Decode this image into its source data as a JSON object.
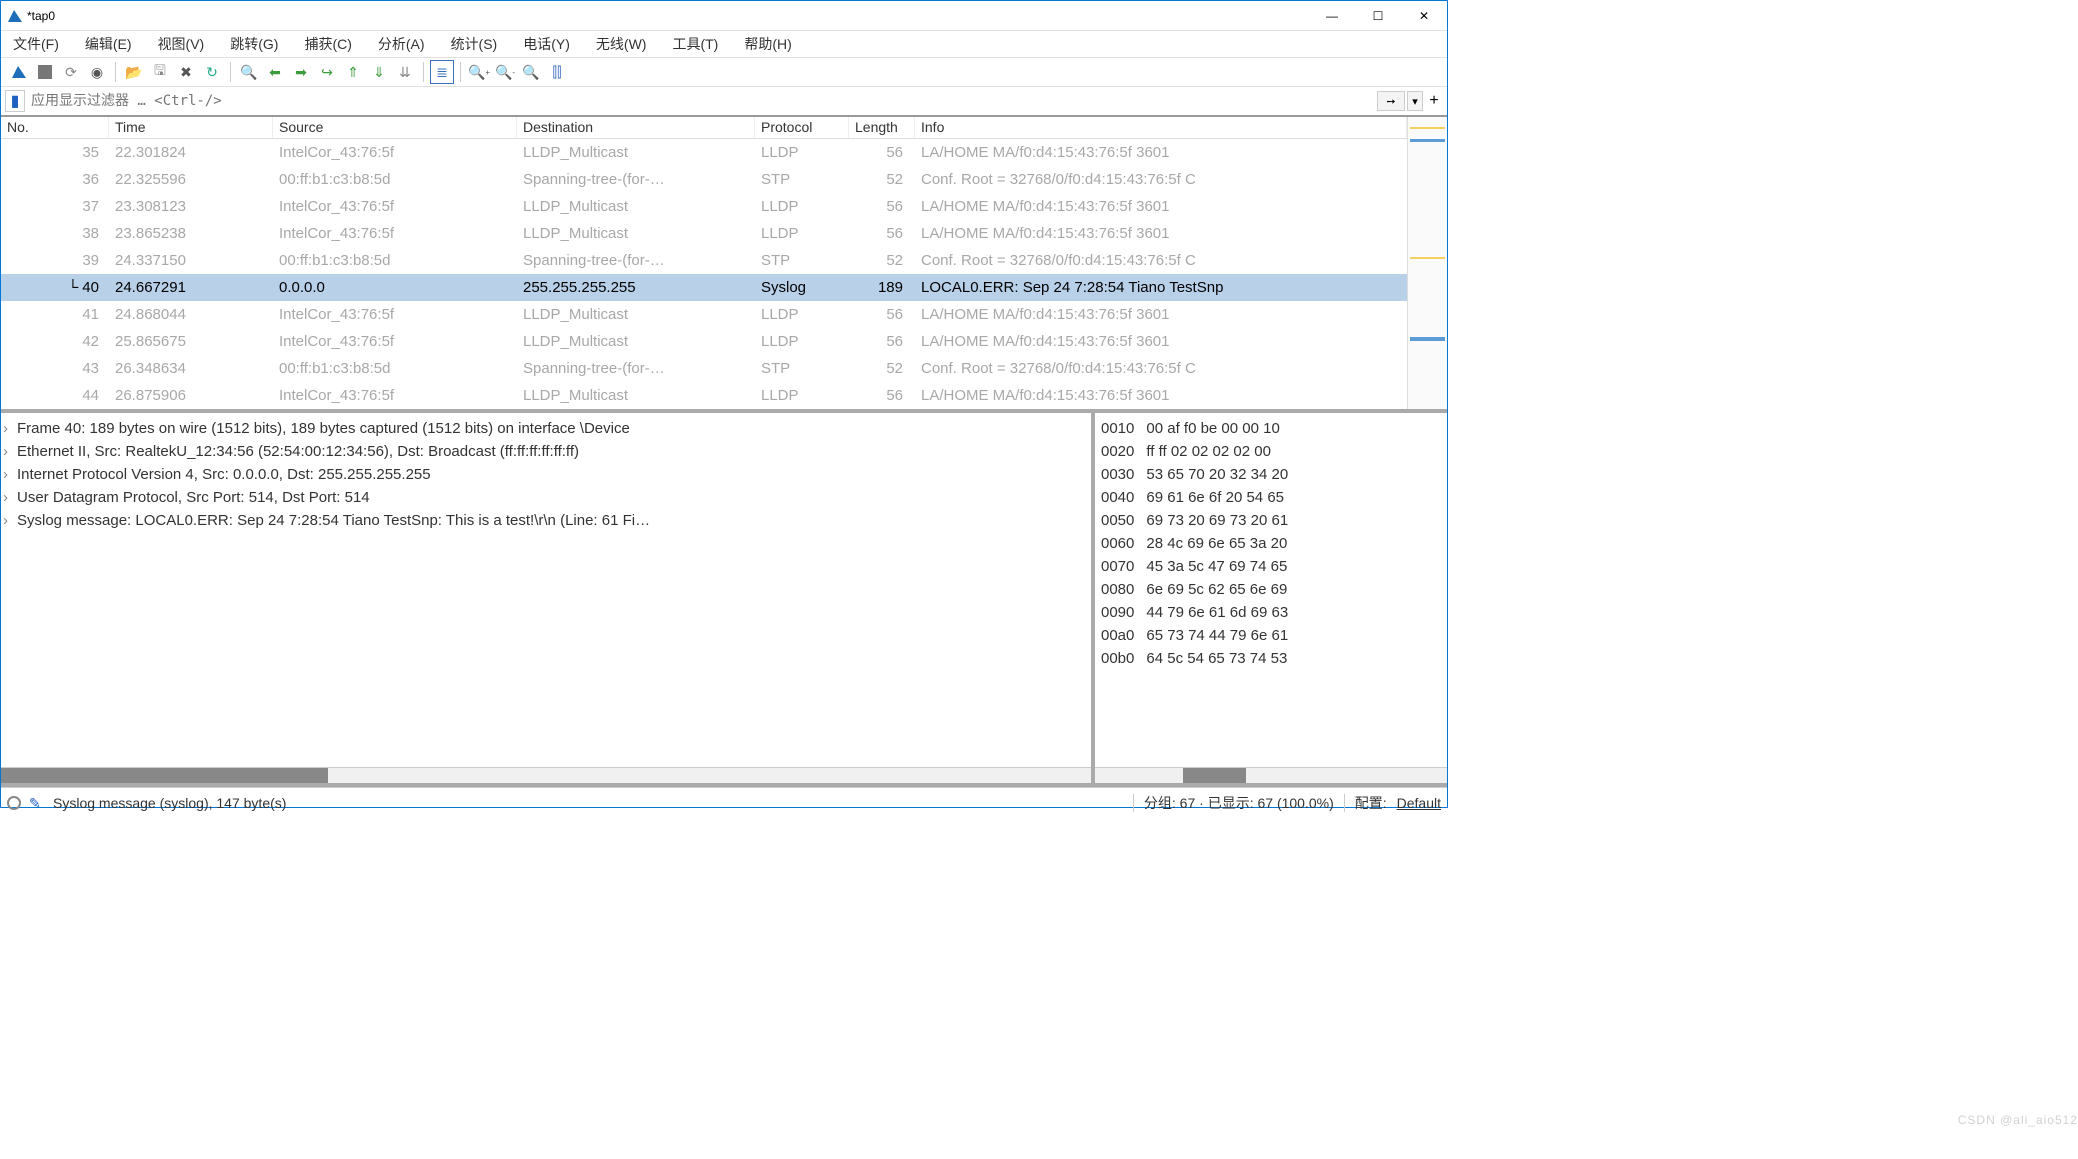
{
  "window": {
    "title": "*tap0"
  },
  "menu": [
    "文件(F)",
    "编辑(E)",
    "视图(V)",
    "跳转(G)",
    "捕获(C)",
    "分析(A)",
    "统计(S)",
    "电话(Y)",
    "无线(W)",
    "工具(T)",
    "帮助(H)"
  ],
  "filter_placeholder": "应用显示过滤器 … <Ctrl-/>",
  "columns": [
    "No.",
    "Time",
    "Source",
    "Destination",
    "Protocol",
    "Length",
    "Info"
  ],
  "packets": [
    {
      "no": "35",
      "time": "22.301824",
      "src": "IntelCor_43:76:5f",
      "dst": "LLDP_Multicast",
      "proto": "LLDP",
      "len": "56",
      "info": "LA/HOME MA/f0:d4:15:43:76:5f 3601",
      "sel": false
    },
    {
      "no": "36",
      "time": "22.325596",
      "src": "00:ff:b1:c3:b8:5d",
      "dst": "Spanning-tree-(for-…",
      "proto": "STP",
      "len": "52",
      "info": "Conf. Root = 32768/0/f0:d4:15:43:76:5f  C",
      "sel": false
    },
    {
      "no": "37",
      "time": "23.308123",
      "src": "IntelCor_43:76:5f",
      "dst": "LLDP_Multicast",
      "proto": "LLDP",
      "len": "56",
      "info": "LA/HOME MA/f0:d4:15:43:76:5f 3601",
      "sel": false
    },
    {
      "no": "38",
      "time": "23.865238",
      "src": "IntelCor_43:76:5f",
      "dst": "LLDP_Multicast",
      "proto": "LLDP",
      "len": "56",
      "info": "LA/HOME MA/f0:d4:15:43:76:5f 3601",
      "sel": false
    },
    {
      "no": "39",
      "time": "24.337150",
      "src": "00:ff:b1:c3:b8:5d",
      "dst": "Spanning-tree-(for-…",
      "proto": "STP",
      "len": "52",
      "info": "Conf. Root = 32768/0/f0:d4:15:43:76:5f  C",
      "sel": false
    },
    {
      "no": "40",
      "time": "24.667291",
      "src": "0.0.0.0",
      "dst": "255.255.255.255",
      "proto": "Syslog",
      "len": "189",
      "info": "LOCAL0.ERR:  Sep 24 7:28:54 Tiano TestSnp",
      "sel": true
    },
    {
      "no": "41",
      "time": "24.868044",
      "src": "IntelCor_43:76:5f",
      "dst": "LLDP_Multicast",
      "proto": "LLDP",
      "len": "56",
      "info": "LA/HOME MA/f0:d4:15:43:76:5f 3601",
      "sel": false
    },
    {
      "no": "42",
      "time": "25.865675",
      "src": "IntelCor_43:76:5f",
      "dst": "LLDP_Multicast",
      "proto": "LLDP",
      "len": "56",
      "info": "LA/HOME MA/f0:d4:15:43:76:5f 3601",
      "sel": false
    },
    {
      "no": "43",
      "time": "26.348634",
      "src": "00:ff:b1:c3:b8:5d",
      "dst": "Spanning-tree-(for-…",
      "proto": "STP",
      "len": "52",
      "info": "Conf. Root = 32768/0/f0:d4:15:43:76:5f  C",
      "sel": false
    },
    {
      "no": "44",
      "time": "26.875906",
      "src": "IntelCor_43:76:5f",
      "dst": "LLDP_Multicast",
      "proto": "LLDP",
      "len": "56",
      "info": "LA/HOME MA/f0:d4:15:43:76:5f 3601",
      "sel": false
    }
  ],
  "tree": [
    "Frame 40: 189 bytes on wire (1512 bits), 189 bytes captured (1512 bits) on interface \\Device",
    "Ethernet II, Src: RealtekU_12:34:56 (52:54:00:12:34:56), Dst: Broadcast (ff:ff:ff:ff:ff:ff)",
    "Internet Protocol Version 4, Src: 0.0.0.0, Dst: 255.255.255.255",
    "User Datagram Protocol, Src Port: 514, Dst Port: 514",
    "Syslog message: LOCAL0.ERR:  Sep 24 7:28:54 Tiano TestSnp: This is a test!\\r\\n (Line: 61 Fi…"
  ],
  "hex": [
    {
      "off": "0010",
      "b": "00 af f0 be 00 00 10 "
    },
    {
      "off": "0020",
      "b": "ff ff 02 02 02 02 00 "
    },
    {
      "off": "0030",
      "b": "53 65 70 20 32 34 20 "
    },
    {
      "off": "0040",
      "b": "69 61 6e 6f 20 54 65 "
    },
    {
      "off": "0050",
      "b": "69 73 20 69 73 20 61 "
    },
    {
      "off": "0060",
      "b": "28 4c 69 6e 65 3a 20 "
    },
    {
      "off": "0070",
      "b": "45 3a 5c 47 69 74 65 "
    },
    {
      "off": "0080",
      "b": "6e 69 5c 62 65 6e 69 "
    },
    {
      "off": "0090",
      "b": "44 79 6e 61 6d 69 63 "
    },
    {
      "off": "00a0",
      "b": "65 73 74 44 79 6e 61 "
    },
    {
      "off": "00b0",
      "b": "64 5c 54 65 73 74 53 "
    }
  ],
  "status": {
    "field": "Syslog message (syslog), 147 byte(s)",
    "packets": "分组: 67 · 已显示: 67 (100.0%)",
    "profile_label": "配置:",
    "profile_value": "Default"
  },
  "watermark": "CSDN @ali_aio512"
}
